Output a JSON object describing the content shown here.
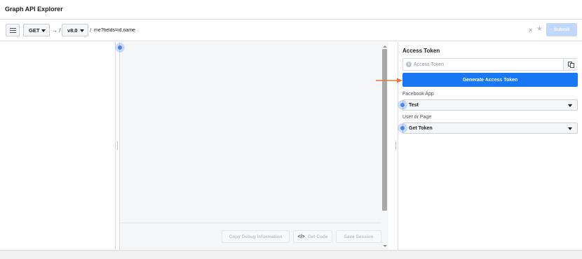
{
  "app": {
    "title": "Graph API Explorer"
  },
  "toolbar": {
    "method": "GET",
    "arrow": "→ /",
    "version": "v8.0",
    "slash": "/",
    "path": "me?fields=id,name",
    "clear_glyph": "×",
    "star_glyph": "★",
    "submit_label": "Submit"
  },
  "editor_footer": {
    "copy_debug_label": "Copy Debug Information",
    "get_code_icon": "</>",
    "get_code_label": "Get Code",
    "save_session_label": "Save Session"
  },
  "right_panel": {
    "section_title": "Access Token",
    "token_placeholder": "Access Token",
    "token_value": "",
    "info_glyph": "i",
    "generate_label": "Generate Access Token",
    "facebook_app_label": "Facebook App",
    "facebook_app_value": "Test",
    "user_or_page_label": "User or Page",
    "user_or_page_value": "Get Token"
  },
  "colors": {
    "primary_blue": "#1877f2",
    "submit_disabled": "#c2d8fb",
    "annotation_arrow": "#e8773a",
    "click_marker": "#4a86e8"
  },
  "icons": [
    "hamburger-menu-icon",
    "chevron-down-icon",
    "clear-icon",
    "star-icon",
    "info-icon",
    "copy-icon",
    "code-icon"
  ]
}
